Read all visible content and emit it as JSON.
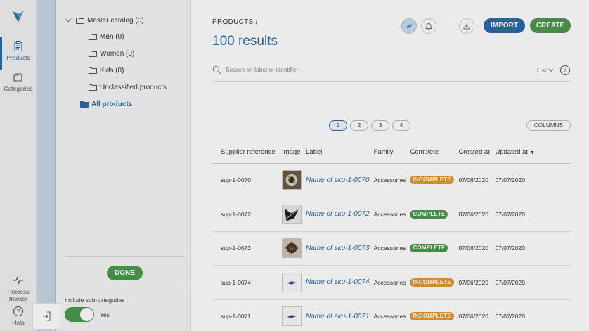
{
  "nav": {
    "products_label": "Products",
    "categories_label": "Categories",
    "process_tracker_label": "Process tracker",
    "help_label": "Help"
  },
  "categories": {
    "tree": [
      {
        "label": "Master catalog (0)"
      },
      {
        "label": "Men (0)"
      },
      {
        "label": "Women (0)"
      },
      {
        "label": "Kids (0)"
      },
      {
        "label": "Unclassified products"
      },
      {
        "label": "All products"
      }
    ],
    "done_label": "DONE",
    "include_sub_label": "Include sub-categories",
    "toggle_value": "Yes"
  },
  "header": {
    "breadcrumb": "PRODUCTS /",
    "results": "100 results",
    "import_label": "IMPORT",
    "create_label": "CREATE"
  },
  "search": {
    "placeholder": "Search on label or identifier",
    "view_mode": "List"
  },
  "pager": {
    "pages": [
      "1",
      "2",
      "3",
      "4"
    ],
    "current": "1",
    "columns_label": "COLUMNS"
  },
  "table": {
    "headers": [
      "Supplier reference",
      "Image",
      "Label",
      "Family",
      "Complete",
      "Created at",
      "Updated at"
    ],
    "rows": [
      {
        "ref": "sup-1-0070",
        "label": "Name of sku-1-0070",
        "family": "Accessories",
        "complete": "INCOMPLETE",
        "created": "07/06/2020",
        "updated": "07/07/2020"
      },
      {
        "ref": "sup-1-0072",
        "label": "Name of sku-1-0072",
        "family": "Accessories",
        "complete": "COMPLETE",
        "created": "07/06/2020",
        "updated": "07/07/2020"
      },
      {
        "ref": "sup-1-0073",
        "label": "Name of sku-1-0073",
        "family": "Accessories",
        "complete": "COMPLETE",
        "created": "07/06/2020",
        "updated": "07/07/2020"
      },
      {
        "ref": "sup-1-0074",
        "label": "Name of sku-1-0074",
        "family": "Accessories",
        "complete": "INCOMPLETE",
        "created": "07/06/2020",
        "updated": "07/07/2020"
      },
      {
        "ref": "sup-1-0071",
        "label": "Name of sku-1-0071",
        "family": "Accessories",
        "complete": "INCOMPLETE",
        "created": "07/06/2020",
        "updated": "07/07/2020"
      }
    ]
  },
  "colors": {
    "accent": "#2a6aa7",
    "success": "#4b9a4e",
    "warning": "#e39a2d"
  }
}
